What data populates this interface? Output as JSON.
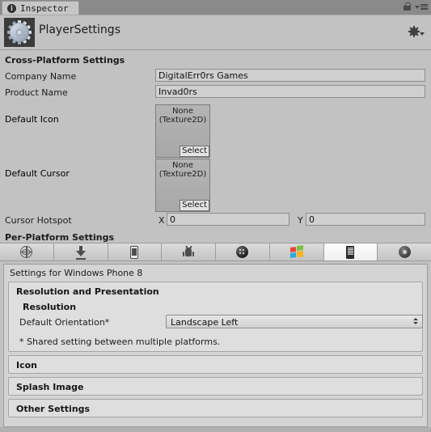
{
  "window": {
    "tab_label": "Inspector",
    "tab_icon": "info-circle-icon",
    "lock_icon": "lock-icon",
    "menu_icon": "hamburger-menu-icon"
  },
  "object_header": {
    "icon": "gear-cog-icon",
    "title": "PlayerSettings",
    "settings_icon": "gear-icon"
  },
  "cross_platform": {
    "section_title": "Cross-Platform Settings",
    "company_name": {
      "label": "Company Name",
      "value": "DigitalErr0rs Games"
    },
    "product_name": {
      "label": "Product Name",
      "value": "Invad0rs"
    },
    "default_icon": {
      "label": "Default Icon",
      "value": "None",
      "type": "(Texture2D)",
      "select_label": "Select"
    },
    "default_cursor": {
      "label": "Default Cursor",
      "value": "None",
      "type": "(Texture2D)",
      "select_label": "Select"
    },
    "cursor_hotspot": {
      "label": "Cursor Hotspot",
      "x_label": "X",
      "x_value": "0",
      "y_label": "Y",
      "y_value": "0"
    }
  },
  "per_platform": {
    "section_title": "Per-Platform Settings",
    "tabs": [
      {
        "name": "web-player",
        "icon": "globe-icon",
        "selected": false
      },
      {
        "name": "standalone",
        "icon": "download-arrow-icon",
        "selected": false
      },
      {
        "name": "ios",
        "icon": "iphone-icon",
        "selected": false
      },
      {
        "name": "android",
        "icon": "android-robot-icon",
        "selected": false
      },
      {
        "name": "blackberry",
        "icon": "blackberry-icon",
        "selected": false
      },
      {
        "name": "windows-store",
        "icon": "windows-flag-icon",
        "selected": false
      },
      {
        "name": "windows-phone",
        "icon": "windows-phone-icon",
        "selected": true
      },
      {
        "name": "tizen",
        "icon": "tizen-icon",
        "selected": false
      }
    ],
    "settings_for": "Settings for Windows Phone 8",
    "resolution_presentation": {
      "header": "Resolution and Presentation",
      "sub_header": "Resolution",
      "default_orientation": {
        "label": "Default Orientation*",
        "value": "Landscape Left"
      },
      "footnote": "* Shared setting between multiple platforms."
    },
    "icon_section": {
      "header": "Icon"
    },
    "splash_section": {
      "header": "Splash Image"
    },
    "other_section": {
      "header": "Other Settings"
    }
  }
}
